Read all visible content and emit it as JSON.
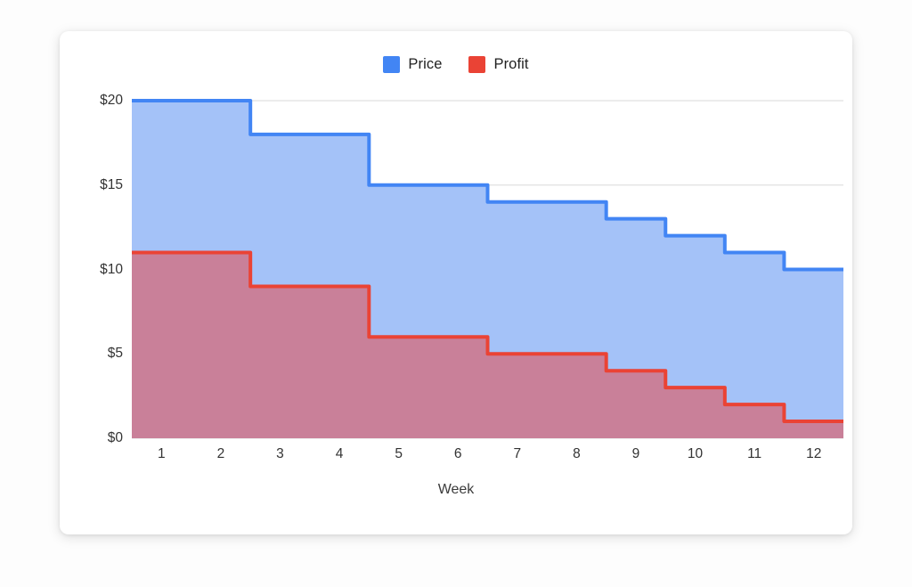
{
  "card": {
    "background": "#ffffff"
  },
  "legend": {
    "position": "top-center",
    "entries": [
      {
        "label": "Price",
        "color": "#4285f4",
        "swatch_name": "legend-swatch-price"
      },
      {
        "label": "Profit",
        "color": "#ea4335",
        "swatch_name": "legend-swatch-profit"
      }
    ]
  },
  "axes": {
    "x_title": "Week",
    "x_tick_labels": [
      "1",
      "2",
      "3",
      "4",
      "5",
      "6",
      "7",
      "8",
      "9",
      "10",
      "11",
      "12"
    ],
    "y_tick_labels": [
      "$0",
      "$5",
      "$10",
      "$15",
      "$20"
    ]
  },
  "colors": {
    "price_line": "#4285f4",
    "price_fill": "#a4c2f8",
    "profit_line": "#ea4335",
    "profit_fill": "#c98099",
    "gridline": "#e0e0e0",
    "text": "#333333",
    "page_background": "#fdfdfd"
  },
  "chart_data": {
    "type": "area",
    "subtype": "stepped-area",
    "step_mode": "step-after-centered",
    "title": "",
    "subtitle": "",
    "xlabel": "Week",
    "ylabel": "",
    "grid": true,
    "legend_position": "top",
    "x": [
      1,
      2,
      3,
      4,
      5,
      6,
      7,
      8,
      9,
      10,
      11,
      12
    ],
    "categories": [
      "1",
      "2",
      "3",
      "4",
      "5",
      "6",
      "7",
      "8",
      "9",
      "10",
      "11",
      "12"
    ],
    "xlim": [
      0.5,
      12.5
    ],
    "ylim": [
      0,
      20
    ],
    "y_ticks": [
      0,
      5,
      10,
      15,
      20
    ],
    "y_tick_format": "$#",
    "x_ticks": [
      1,
      2,
      3,
      4,
      5,
      6,
      7,
      8,
      9,
      10,
      11,
      12
    ],
    "series": [
      {
        "name": "Price",
        "color": "#4285f4",
        "fill": "#a4c2f8",
        "values": [
          20,
          20,
          18,
          18,
          15,
          15,
          14,
          14,
          13,
          12,
          11,
          10
        ]
      },
      {
        "name": "Profit",
        "color": "#ea4335",
        "fill": "#c98099",
        "values": [
          11,
          11,
          9,
          9,
          6,
          6,
          5,
          5,
          4,
          3,
          2,
          1
        ]
      }
    ],
    "annotations": []
  }
}
